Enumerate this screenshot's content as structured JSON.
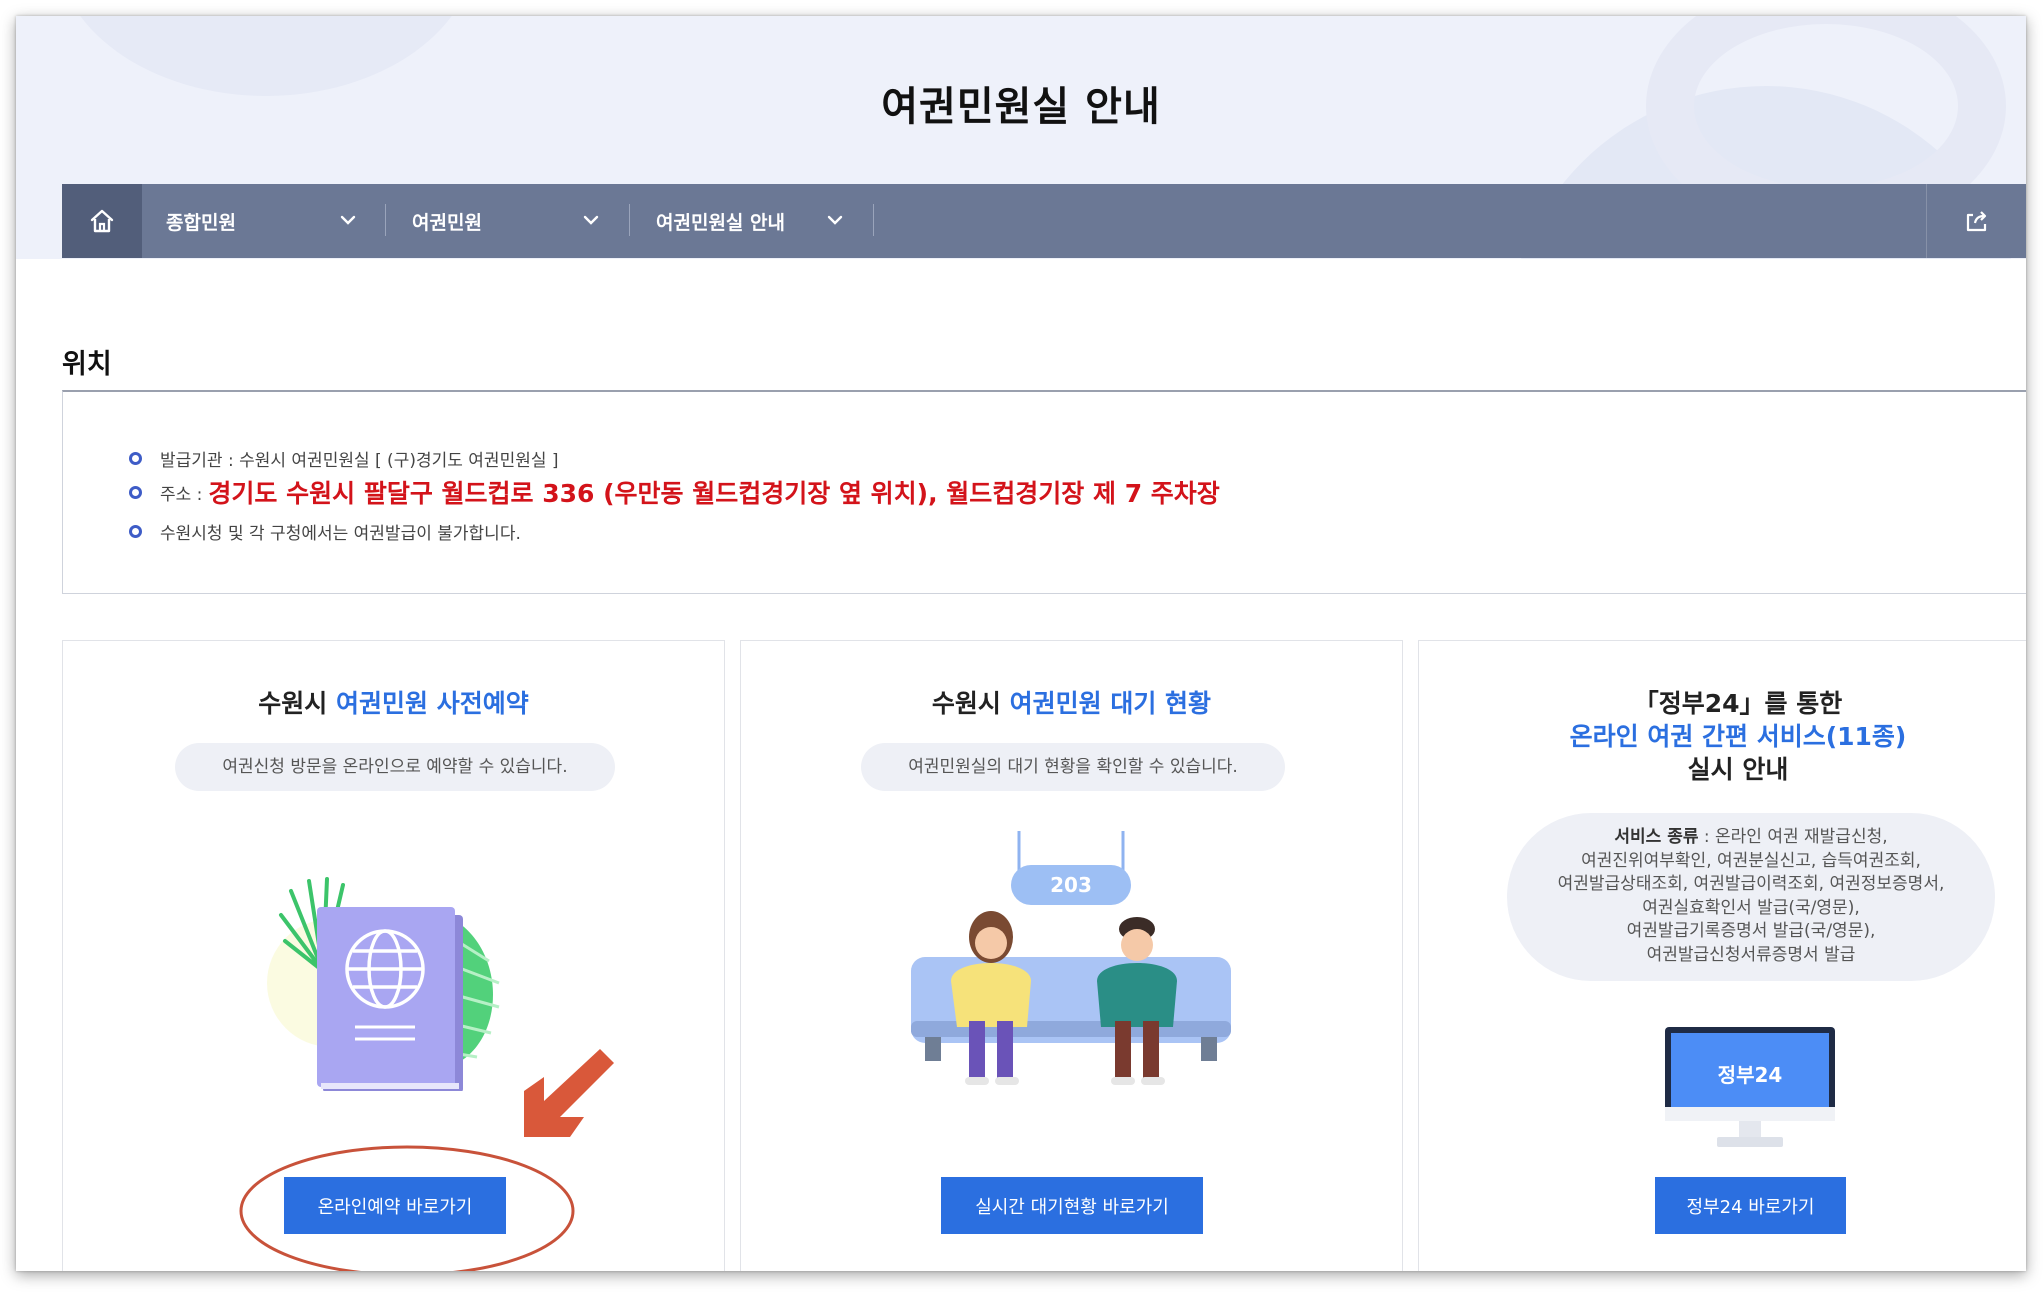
{
  "page": {
    "title": "여권민원실 안내"
  },
  "nav": {
    "items": [
      {
        "label": "종합민원"
      },
      {
        "label": "여권민원"
      },
      {
        "label": "여권민원실 안내"
      }
    ],
    "icons": {
      "home": "home-icon",
      "share": "share-icon",
      "dropdown": "chevron-down-icon"
    }
  },
  "location": {
    "heading": "위치",
    "issuer": "발급기관 : 수원시 여권민원실 [ (구)경기도 여권민원실 ]",
    "address_label": "주소 :",
    "address_value": "경기도 수원시 팔달구 월드컵로 336 (우만동 월드컵경기장 옆 위치),  월드컵경기장 제 7 주차장",
    "notice": "수원시청 및 각 구청에서는 여권발급이 불가합니다."
  },
  "cards": [
    {
      "title_prefix": "수원시 ",
      "title_highlight": "여권민원 사전예약",
      "desc": "여권신청 방문을 온라인으로 예약할 수 있습니다.",
      "button": "온라인예약 바로가기"
    },
    {
      "title_prefix": "수원시 ",
      "title_highlight": "여권민원 대기 현황",
      "desc": "여권민원실의 대기 현황을 확인할 수 있습니다.",
      "sign": "203",
      "button": "실시간 대기현황 바로가기"
    },
    {
      "title_line1": "「정부24」를 통한",
      "title_line2": "온라인 여권 간편 서비스(11종)",
      "title_line3": "실시 안내",
      "service_label": "서비스 종류",
      "service_lines": [
        " : 온라인 여권 재발급신청,",
        "여권진위여부확인, 여권분실신고, 습득여권조회,",
        "여권발급상태조회, 여권발급이력조회, 여권정보증명서,",
        "여권실효확인서 발급(국/영문),",
        "여권발급기록증명서 발급(국/영문),",
        "여권발급신청서류증명서 발급"
      ],
      "screen_text": "정부24",
      "button": "정부24 바로가기"
    }
  ],
  "colors": {
    "accent": "#2b6fe0",
    "nav": "#6b7895",
    "address": "#d3131a",
    "annotation": "#d9583a"
  }
}
